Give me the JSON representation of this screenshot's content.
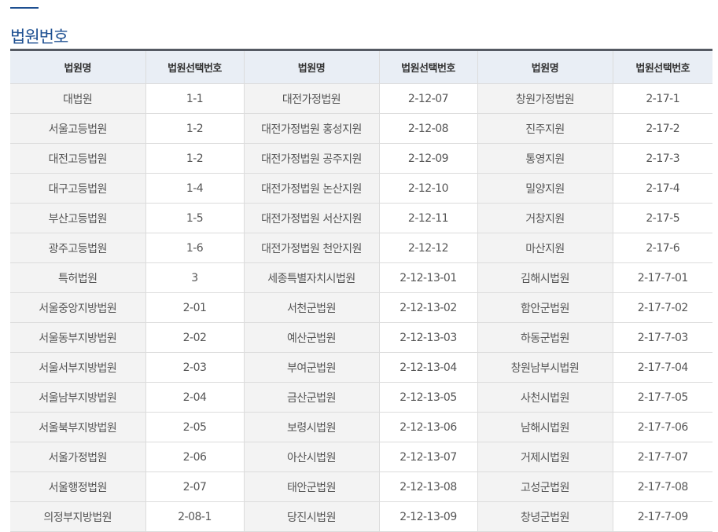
{
  "page": {
    "title": "법원번호"
  },
  "table": {
    "headers": [
      "법원명",
      "법원선택번호",
      "법원명",
      "법원선택번호",
      "법원명",
      "법원선택번호"
    ],
    "rows": [
      [
        "대법원",
        "1-1",
        "대전가정법원",
        "2-12-07",
        "창원가정법원",
        "2-17-1"
      ],
      [
        "서울고등법원",
        "1-2",
        "대전가정법원 홍성지원",
        "2-12-08",
        "진주지원",
        "2-17-2"
      ],
      [
        "대전고등법원",
        "1-2",
        "대전가정법원 공주지원",
        "2-12-09",
        "통영지원",
        "2-17-3"
      ],
      [
        "대구고등법원",
        "1-4",
        "대전가정법원 논산지원",
        "2-12-10",
        "밀양지원",
        "2-17-4"
      ],
      [
        "부산고등법원",
        "1-5",
        "대전가정법원 서산지원",
        "2-12-11",
        "거창지원",
        "2-17-5"
      ],
      [
        "광주고등법원",
        "1-6",
        "대전가정법원 천안지원",
        "2-12-12",
        "마산지원",
        "2-17-6"
      ],
      [
        "특허법원",
        "3",
        "세종특별자치시법원",
        "2-12-13-01",
        "김해시법원",
        "2-17-7-01"
      ],
      [
        "서울중앙지방법원",
        "2-01",
        "서천군법원",
        "2-12-13-02",
        "함안군법원",
        "2-17-7-02"
      ],
      [
        "서울동부지방법원",
        "2-02",
        "예산군법원",
        "2-12-13-03",
        "하동군법원",
        "2-17-7-03"
      ],
      [
        "서울서부지방법원",
        "2-03",
        "부여군법원",
        "2-12-13-04",
        "창원남부시법원",
        "2-17-7-04"
      ],
      [
        "서울남부지방법원",
        "2-04",
        "금산군법원",
        "2-12-13-05",
        "사천시법원",
        "2-17-7-05"
      ],
      [
        "서울북부지방법원",
        "2-05",
        "보령시법원",
        "2-12-13-06",
        "남해시법원",
        "2-17-7-06"
      ],
      [
        "서울가정법원",
        "2-06",
        "아산시법원",
        "2-12-13-07",
        "거제시법원",
        "2-17-7-07"
      ],
      [
        "서울행정법원",
        "2-07",
        "태안군법원",
        "2-12-13-08",
        "고성군법원",
        "2-17-7-08"
      ],
      [
        "의정부지방법원",
        "2-08-1",
        "당진시법원",
        "2-12-13-09",
        "창녕군법원",
        "2-17-7-09"
      ]
    ]
  }
}
